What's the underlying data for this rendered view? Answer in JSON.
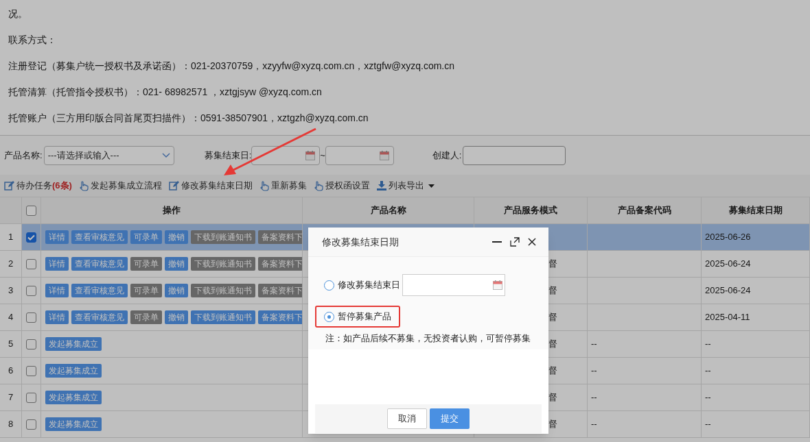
{
  "intro_lines": [
    "况。",
    "联系方式：",
    "注册登记（募集户统一授权书及承诺函）：021-20370759，xzyyfw@xyzq.com.cn，xztgfw@xyzq.com.cn",
    "托管清算（托管指令授权书）：021- 68982571 ，xztgjsyw @xyzq.com.cn",
    "托管账户（三方用印版合同首尾页扫描件）：0591-38507901，xztgzh@xyzq.com.cn"
  ],
  "filters": {
    "product_name": {
      "label": "产品名称:",
      "placeholder": "---请选择或输入---"
    },
    "end_date": {
      "label": "募集结束日:",
      "separator": "~"
    },
    "creator": {
      "label": "创建人:"
    }
  },
  "toolbar": [
    {
      "label": "待办任务",
      "count": "(6条)",
      "kind": "edit",
      "dropdown": false
    },
    {
      "label": "发起募集成立流程",
      "kind": "hand",
      "dropdown": false
    },
    {
      "label": "修改募集结束日期",
      "kind": "edit",
      "dropdown": false
    },
    {
      "label": "重新募集",
      "kind": "hand",
      "dropdown": false
    },
    {
      "label": "授权函设置",
      "kind": "hand",
      "dropdown": false
    },
    {
      "label": "列表导出",
      "kind": "download",
      "dropdown": true
    }
  ],
  "table": {
    "header_checked": false,
    "columns": [
      "操作",
      "产品名称",
      "产品服务模式",
      "产品备案代码",
      "募集结束日期"
    ],
    "rows": [
      {
        "number": "1",
        "checked": true,
        "selected": true,
        "actions": [
          {
            "label": "详情",
            "disabled": false
          },
          {
            "label": "查看审核意见",
            "disabled": false
          },
          {
            "label": "可录单",
            "disabled": false
          },
          {
            "label": "撤销",
            "disabled": false
          },
          {
            "label": "下载到账通知书",
            "disabled": true
          },
          {
            "label": "备案资料下",
            "disabled": true
          }
        ],
        "end_date": "2025-06-26"
      },
      {
        "number": "2",
        "checked": false,
        "selected": false,
        "actions": [
          {
            "label": "详情",
            "disabled": false
          },
          {
            "label": "查看审核意见",
            "disabled": false
          },
          {
            "label": "可录单",
            "disabled": true
          },
          {
            "label": "撤销",
            "disabled": false
          },
          {
            "label": "下载到账通知书",
            "disabled": true
          },
          {
            "label": "备案资料下",
            "disabled": true
          }
        ],
        "service_mode": "督",
        "end_date": "2025-06-24"
      },
      {
        "number": "3",
        "checked": false,
        "selected": false,
        "actions": [
          {
            "label": "详情",
            "disabled": false
          },
          {
            "label": "查看审核意见",
            "disabled": false
          },
          {
            "label": "可录单",
            "disabled": true
          },
          {
            "label": "撤销",
            "disabled": false
          },
          {
            "label": "下载到账通知书",
            "disabled": true
          },
          {
            "label": "备案资料下",
            "disabled": true
          }
        ],
        "service_mode": "督",
        "end_date": "2025-06-24"
      },
      {
        "number": "4",
        "checked": false,
        "selected": false,
        "actions": [
          {
            "label": "详情",
            "disabled": false
          },
          {
            "label": "查看审核意见",
            "disabled": false
          },
          {
            "label": "可录单",
            "disabled": true
          },
          {
            "label": "撤销",
            "disabled": false
          },
          {
            "label": "下载到账通知书",
            "disabled": false
          },
          {
            "label": "备案资料下",
            "disabled": false
          }
        ],
        "service_mode": "督",
        "end_date": "2025-04-11"
      },
      {
        "number": "5",
        "checked": false,
        "selected": false,
        "actions": [
          {
            "label": "发起募集成立",
            "disabled": false
          }
        ],
        "service_mode": "督",
        "filing_code": "--",
        "end_date": "--"
      },
      {
        "number": "6",
        "checked": false,
        "selected": false,
        "actions": [
          {
            "label": "发起募集成立",
            "disabled": false
          }
        ],
        "service_mode": "督",
        "filing_code": "--",
        "end_date": "--"
      },
      {
        "number": "7",
        "checked": false,
        "selected": false,
        "actions": [
          {
            "label": "发起募集成立",
            "disabled": false
          }
        ],
        "service_mode": "督",
        "filing_code": "--",
        "end_date": "--"
      },
      {
        "number": "8",
        "checked": false,
        "selected": false,
        "actions": [
          {
            "label": "发起募集成立",
            "disabled": false
          }
        ],
        "service_mode": "督",
        "filing_code": "--",
        "end_date": "--"
      }
    ]
  },
  "dialog": {
    "title": "修改募集结束日期",
    "options": [
      {
        "kind": "date",
        "label": "修改募集结束日",
        "selected": false,
        "highlighted": false
      },
      {
        "kind": "plain",
        "label": "暂停募集产品",
        "selected": true,
        "highlighted": true
      }
    ],
    "note": "注：如产品后续不募集，无投资者认购，可暂停募集",
    "buttons": [
      {
        "label": "取消",
        "primary": false
      },
      {
        "label": "提交",
        "primary": true
      }
    ]
  }
}
